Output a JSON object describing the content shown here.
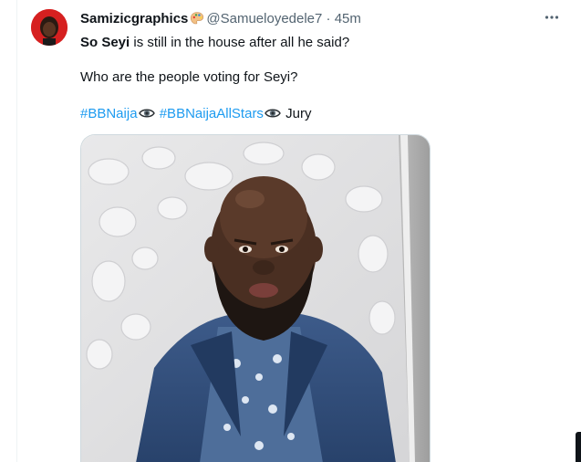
{
  "tweet": {
    "author_name": "Samizicgraphics",
    "author_handle": "@Samueloyedele7",
    "separator": "·",
    "time": "45m",
    "line1_bold": "So Seyi",
    "line1_rest": " is still in the house after all he said?",
    "line2": "Who are the people voting for Seyi?",
    "hashtag1": "#BBNaija",
    "hashtag2": "#BBNaijaAllStars",
    "line3_rest": " Jury"
  },
  "icons": {
    "author_badge": "palette-emoji-icon",
    "more": "more-horizontal-icon",
    "eye": "eye-emoji-icon"
  },
  "colors": {
    "link": "#1d9bf0",
    "secondary_text": "#536471",
    "primary_text": "#0f1419"
  }
}
